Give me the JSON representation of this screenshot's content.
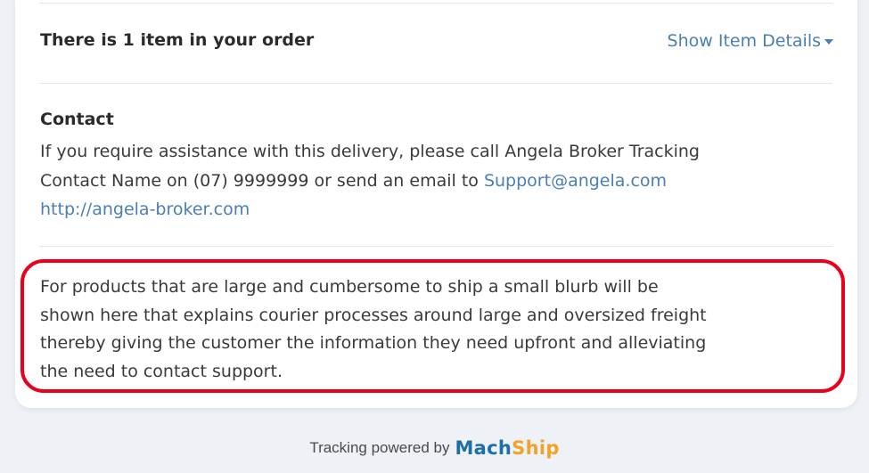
{
  "order": {
    "summary": "There is 1 item in your order",
    "details_link": "Show Item Details"
  },
  "contact": {
    "heading": "Contact",
    "line1": "If you require assistance with this delivery, please call Angela Broker Tracking",
    "line2_prefix": "Contact Name on (07) 9999999 or send an email to ",
    "email": "Support@angela.com",
    "website": "http://angela-broker.com"
  },
  "blurb": {
    "lines": [
      "For products that are large and cumbersome to ship a small blurb will be",
      "shown here that explains courier processes around large and oversized freight",
      "thereby giving the customer the information they need upfront and alleviating",
      "the need to contact support."
    ]
  },
  "footer": {
    "prefix": "Tracking powered by",
    "logo_part1": "Mach",
    "logo_part2": "Ship"
  },
  "colors": {
    "link": "#4a7fb5",
    "highlight_border": "#e8001c",
    "logo_primary": "#1d6fa5",
    "logo_secondary": "#f0a22a"
  }
}
